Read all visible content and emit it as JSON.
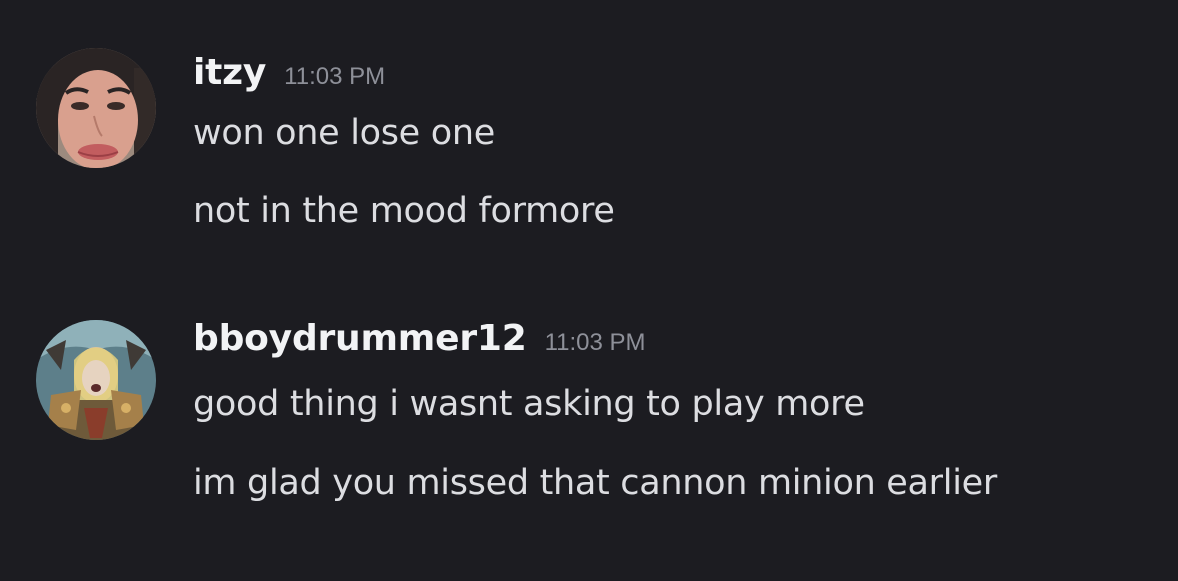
{
  "messages": [
    {
      "author": "itzy",
      "timestamp": "11:03 PM",
      "lines": [
        "won one lose one",
        "not in the mood formore"
      ]
    },
    {
      "author": "bboydrummer12",
      "timestamp": "11:03 PM",
      "lines": [
        "good thing i wasnt asking to play more",
        "im glad you missed that cannon minion earlier"
      ]
    }
  ],
  "colors": {
    "background": "#1c1c21",
    "username": "#f2f3f5",
    "timestamp": "#8e9099",
    "message_text": "#dcdde1"
  }
}
